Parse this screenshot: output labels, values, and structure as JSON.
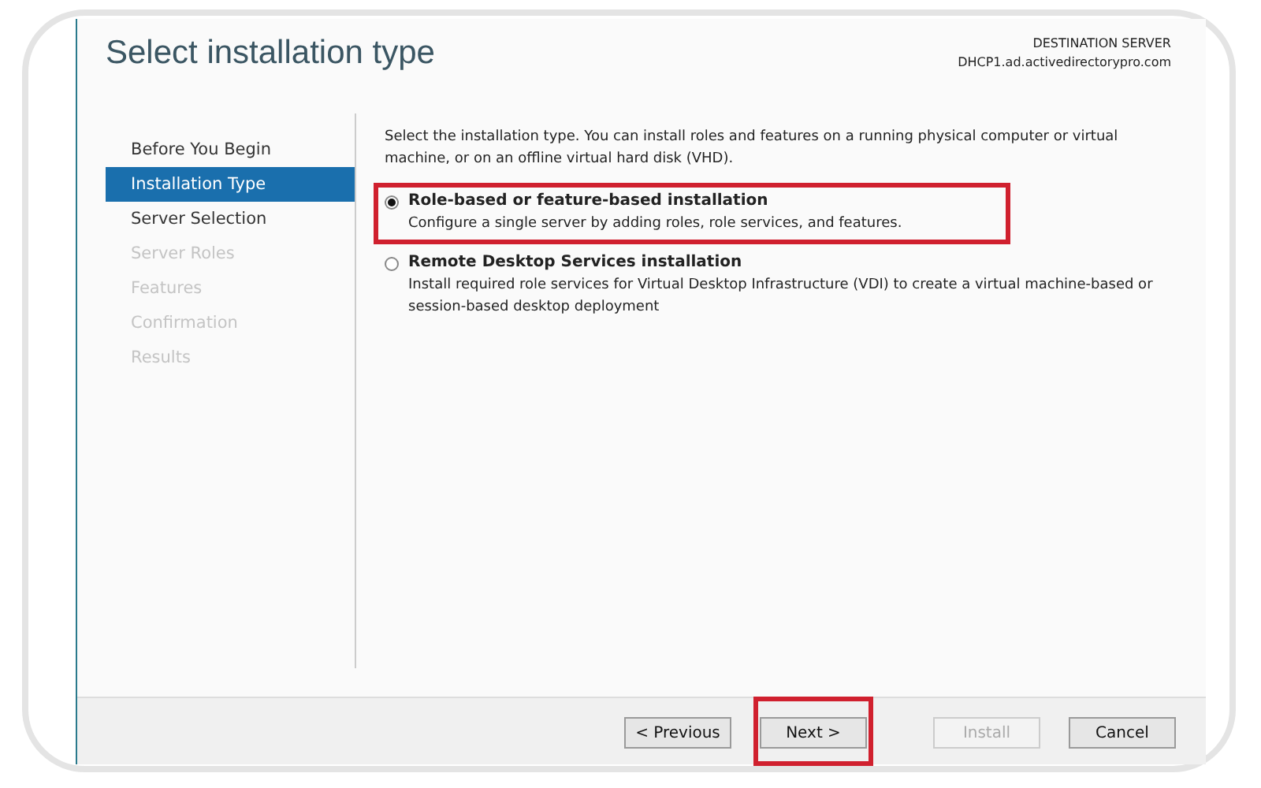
{
  "window": {
    "title": "Select installation type"
  },
  "destination": {
    "label": "DESTINATION SERVER",
    "server": "DHCP1.ad.activedirectorypro.com"
  },
  "steps": [
    {
      "label": "Before You Begin",
      "selected": false,
      "disabled": false
    },
    {
      "label": "Installation Type",
      "selected": true,
      "disabled": false
    },
    {
      "label": "Server Selection",
      "selected": false,
      "disabled": false
    },
    {
      "label": "Server Roles",
      "selected": false,
      "disabled": true
    },
    {
      "label": "Features",
      "selected": false,
      "disabled": true
    },
    {
      "label": "Confirmation",
      "selected": false,
      "disabled": true
    },
    {
      "label": "Results",
      "selected": false,
      "disabled": true
    }
  ],
  "intro": "Select the installation type. You can install roles and features on a running physical computer or virtual machine, or on an offline virtual hard disk (VHD).",
  "options": [
    {
      "title": "Role-based or feature-based installation",
      "description": "Configure a single server by adding roles, role services, and features.",
      "selected": true,
      "highlighted": true
    },
    {
      "title": "Remote Desktop Services installation",
      "description": "Install required role services for Virtual Desktop Infrastructure (VDI) to create a virtual machine-based or session-based desktop deployment",
      "selected": false,
      "highlighted": false
    }
  ],
  "buttons": [
    {
      "label": "< Previous",
      "disabled": false,
      "highlighted": false
    },
    {
      "label": "Next >",
      "disabled": false,
      "highlighted": true
    },
    {
      "label": "Install",
      "disabled": true,
      "highlighted": false
    },
    {
      "label": "Cancel",
      "disabled": false,
      "highlighted": false
    }
  ]
}
